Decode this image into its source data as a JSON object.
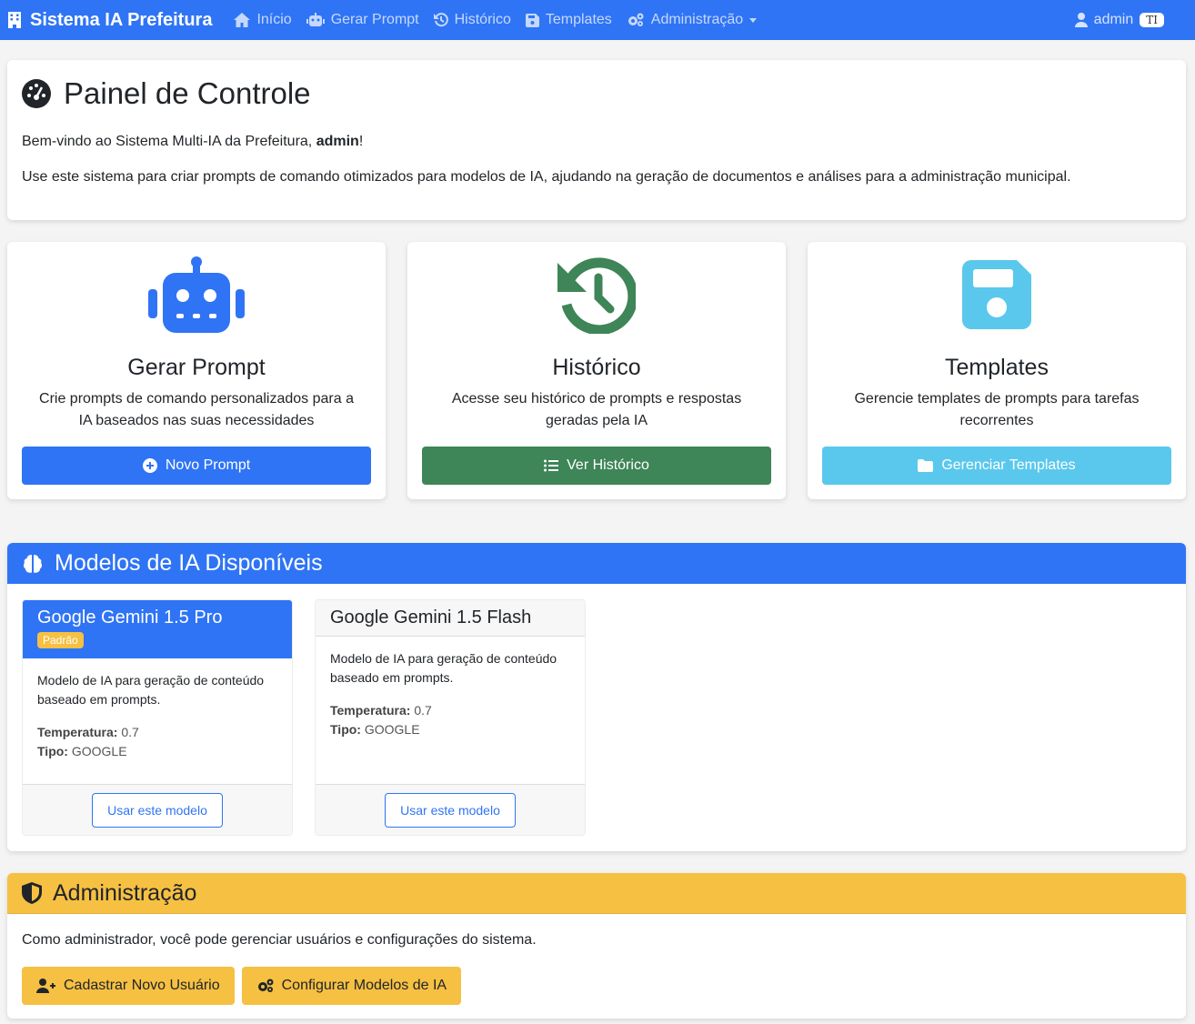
{
  "navbar": {
    "brand": "Sistema IA Prefeitura",
    "items": [
      {
        "label": "Início",
        "icon": "home-icon"
      },
      {
        "label": "Gerar Prompt",
        "icon": "robot-icon"
      },
      {
        "label": "Histórico",
        "icon": "history-icon"
      },
      {
        "label": "Templates",
        "icon": "save-icon"
      },
      {
        "label": "Administração",
        "icon": "cogs-icon"
      }
    ],
    "user": "admin",
    "user_badge": "TI"
  },
  "welcome": {
    "title": "Painel de Controle",
    "greeting_prefix": "Bem-vindo ao Sistema Multi-IA da Prefeitura, ",
    "greeting_user": "admin",
    "greeting_suffix": "!",
    "description": "Use este sistema para criar prompts de comando otimizados para modelos de IA, ajudando na geração de documentos e análises para a administração municipal."
  },
  "features": [
    {
      "title": "Gerar Prompt",
      "description": "Crie prompts de comando personalizados para a IA baseados nas suas necessidades",
      "button": "Novo Prompt",
      "color": "#2f74f5"
    },
    {
      "title": "Histórico",
      "description": "Acesse seu histórico de prompts e respostas geradas pela IA",
      "button": "Ver Histórico",
      "color": "#3e8557"
    },
    {
      "title": "Templates",
      "description": "Gerencie templates de prompts para tarefas recorrentes",
      "button": "Gerenciar Templates",
      "color": "#5ac8ec"
    }
  ],
  "models": {
    "title": "Modelos de IA Disponíveis",
    "cards": [
      {
        "name": "Google Gemini 1.5 Pro",
        "badge": "Padrão",
        "description": "Modelo de IA para geração de conteúdo baseado em prompts.",
        "temp_label": "Temperatura:",
        "temp": "0.7",
        "type_label": "Tipo:",
        "type": "GOOGLE",
        "button": "Usar este modelo"
      },
      {
        "name": "Google Gemini 1.5 Flash",
        "description": "Modelo de IA para geração de conteúdo baseado em prompts.",
        "temp_label": "Temperatura:",
        "temp": "0.7",
        "type_label": "Tipo:",
        "type": "GOOGLE",
        "button": "Usar este modelo"
      }
    ]
  },
  "admin": {
    "title": "Administração",
    "description": "Como administrador, você pode gerenciar usuários e configurações do sistema.",
    "buttons": [
      "Cadastrar Novo Usuário",
      "Configurar Modelos de IA"
    ]
  },
  "colors": {
    "primary": "#2f74f5",
    "success": "#3e8557",
    "info": "#5ac8ec",
    "warning": "#f6c042"
  }
}
